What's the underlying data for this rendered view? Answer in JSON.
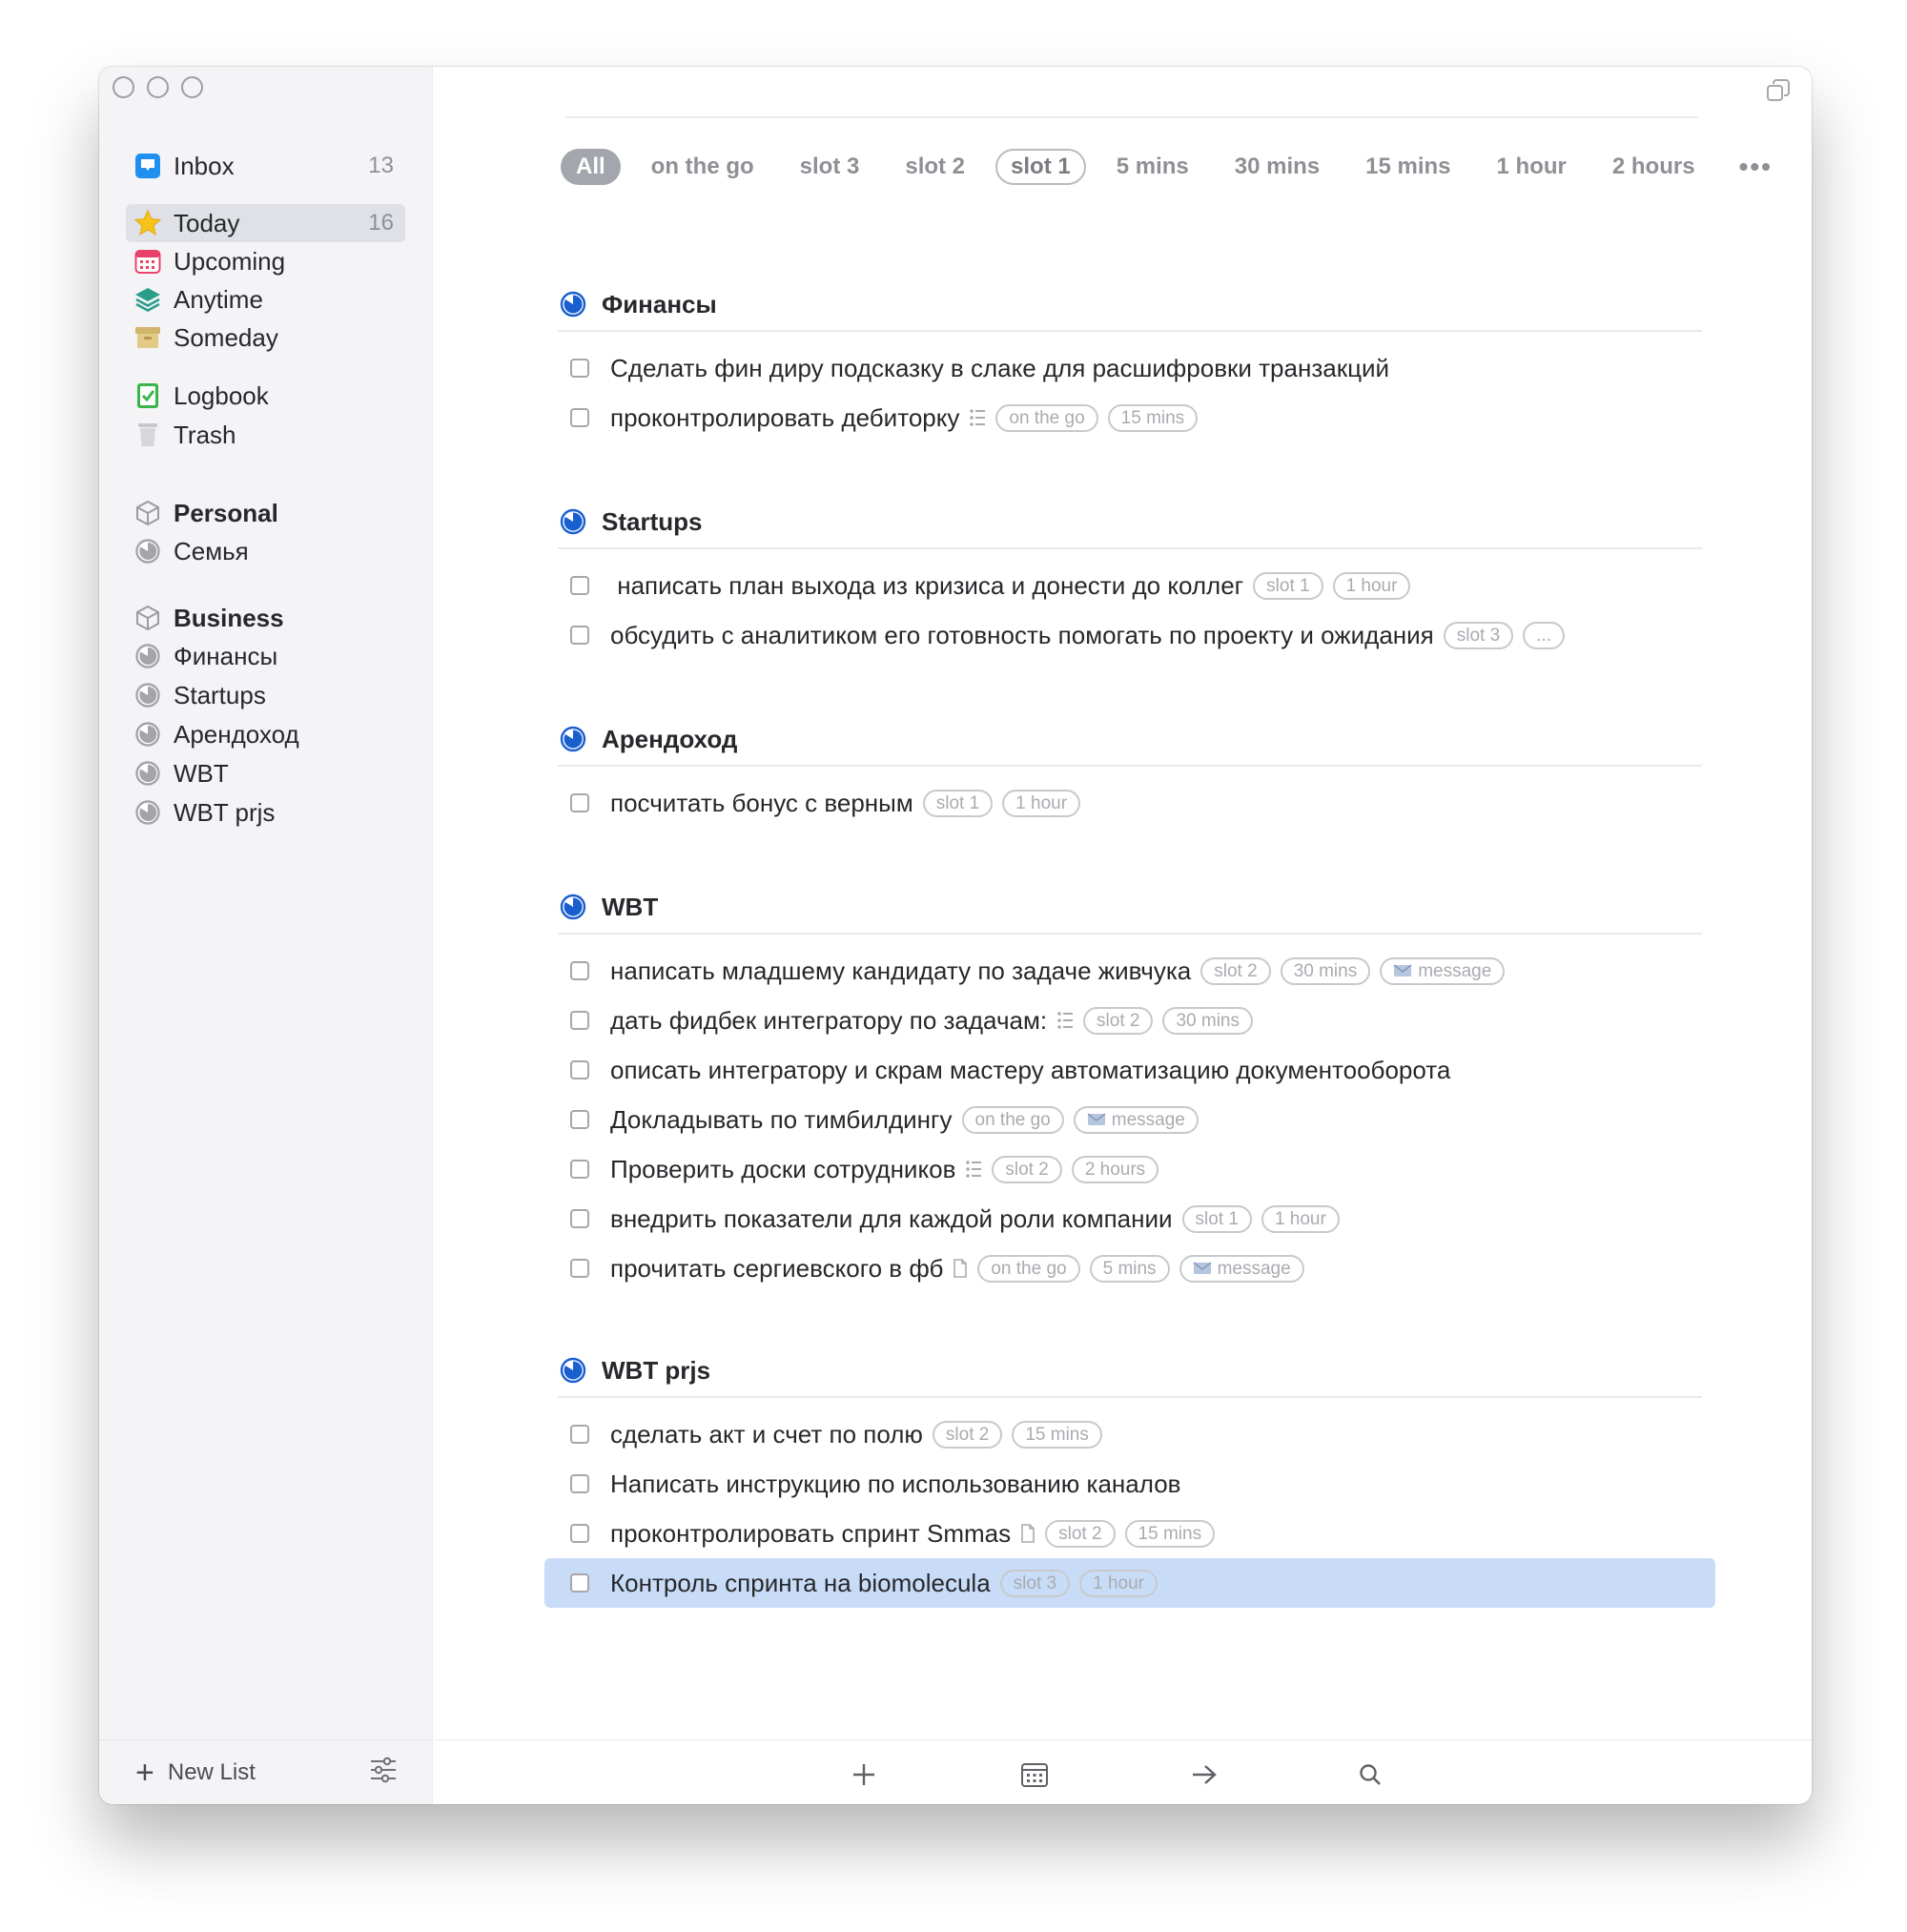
{
  "sidebar": {
    "inbox": {
      "label": "Inbox",
      "count": "13"
    },
    "today": {
      "label": "Today",
      "count": "16"
    },
    "upcoming": {
      "label": "Upcoming"
    },
    "anytime": {
      "label": "Anytime"
    },
    "someday": {
      "label": "Someday"
    },
    "logbook": {
      "label": "Logbook"
    },
    "trash": {
      "label": "Trash"
    },
    "areas": [
      {
        "label": "Personal",
        "projects": [
          "Семья"
        ]
      },
      {
        "label": "Business",
        "projects": [
          "Финансы",
          "Startups",
          "Арендоход",
          "WBT",
          "WBT prjs"
        ]
      }
    ],
    "new_list": "New List"
  },
  "filters": [
    "All",
    "on the go",
    "slot 3",
    "slot 2",
    "slot 1",
    "5 mins",
    "30 mins",
    "15 mins",
    "1 hour",
    "2 hours",
    "•••"
  ],
  "sections": [
    {
      "title": "Финансы",
      "tasks": [
        {
          "title": "Сделать фин диру подсказку в слаке для расшифровки транзакций",
          "tags": []
        },
        {
          "title": "проконтролировать дебиторку",
          "tags": [
            "on the go",
            "15 mins"
          ]
        }
      ]
    },
    {
      "title": "Startups",
      "tasks": [
        {
          "title": " написать план выхода из кризиса и донести до коллег",
          "tags": [
            "slot 1",
            "1 hour"
          ]
        },
        {
          "title": "обсудить с аналитиком его готовность помогать по проекту и ожидания",
          "tags": [
            "slot 3",
            "..."
          ]
        }
      ]
    },
    {
      "title": "Арендоход",
      "tasks": [
        {
          "title": "посчитать бонус с верным",
          "tags": [
            "slot 1",
            "1 hour"
          ]
        }
      ]
    },
    {
      "title": "WBT",
      "tasks": [
        {
          "title": "написать младшему кандидату по задаче живчука",
          "tags": [
            "slot 2",
            "30 mins",
            "message"
          ]
        },
        {
          "title": "дать фидбек интегратору по задачам:",
          "tags": [
            "slot 2",
            "30 mins"
          ]
        },
        {
          "title": "описать интегратору и скрам мастеру автоматизацию документооборота",
          "tags": []
        },
        {
          "title": "Докладывать по тимбилдингу",
          "tags": [
            "on the go",
            "message"
          ]
        },
        {
          "title": "Проверить доски сотрудников",
          "tags": [
            "slot 2",
            "2 hours"
          ]
        },
        {
          "title": "внедрить показатели для каждой роли компании",
          "tags": [
            "slot 1",
            "1 hour"
          ]
        },
        {
          "title": "прочитать сергиевского в фб",
          "tags": [
            "on the go",
            "5 mins",
            "message"
          ]
        }
      ]
    },
    {
      "title": "WBT prjs",
      "tasks": [
        {
          "title": "сделать акт и счет по полю",
          "tags": [
            "slot 2",
            "15 mins"
          ]
        },
        {
          "title": "Написать инструкцию по использованию каналов",
          "tags": []
        },
        {
          "title": "проконтролировать спринт Smmas",
          "tags": [
            "slot 2",
            "15 mins"
          ]
        },
        {
          "title": "Контроль спринта на biomolecula",
          "tags": [
            "slot 3",
            "1 hour"
          ]
        }
      ]
    }
  ],
  "colors": {
    "accent": "#1a5fd0",
    "selected_row": "#c9dcf7",
    "sidebar_bg": "#f4f4f6"
  }
}
